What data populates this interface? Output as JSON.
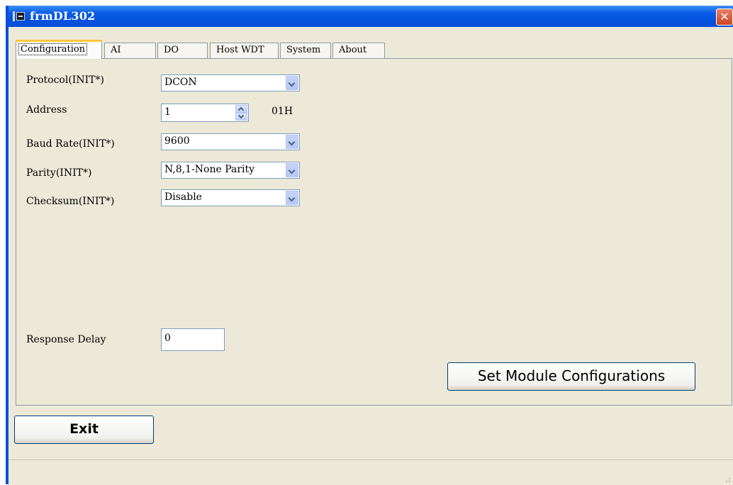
{
  "window": {
    "title": "frmDL302",
    "close_symbol": "✕"
  },
  "tabs": [
    {
      "label": "Configuration",
      "active": true
    },
    {
      "label": "AI"
    },
    {
      "label": "DO"
    },
    {
      "label": "Host WDT"
    },
    {
      "label": "System"
    },
    {
      "label": "About"
    }
  ],
  "config": {
    "protocol": {
      "label": "Protocol(INIT*)",
      "value": "DCON"
    },
    "address": {
      "label": "Address",
      "value": "1",
      "hex": "01H"
    },
    "baud": {
      "label": "Baud Rate(INIT*)",
      "value": "9600"
    },
    "parity": {
      "label": "Parity(INIT*)",
      "value": "N,8,1-None Parity"
    },
    "checksum": {
      "label": "Checksum(INIT*)",
      "value": "Disable"
    },
    "response_delay": {
      "label": "Response Delay",
      "value": "0"
    },
    "set_button": "Set Module Configurations"
  },
  "exit_button": "Exit",
  "icons": {
    "app": "app-icon",
    "close": "close-icon",
    "dropdown": "chevron-down-icon",
    "spin_up": "chevron-up-icon",
    "spin_down": "chevron-down-icon",
    "grip": "resize-grip-icon"
  },
  "colors": {
    "titlebar": "#0a5be4",
    "window_bg": "#ece9d8",
    "active_tab_accent": "#ffc83c",
    "close_button": "#d0451f"
  }
}
